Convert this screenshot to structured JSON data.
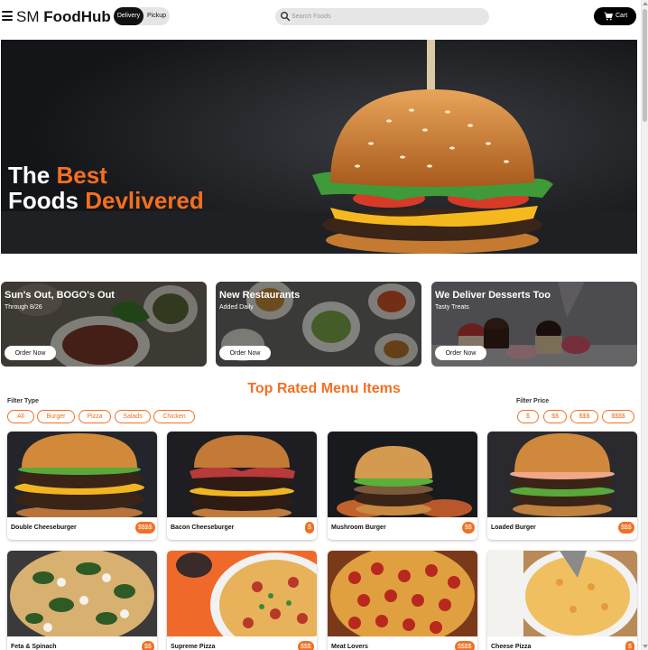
{
  "header": {
    "brand_prefix": "SM",
    "brand_name": "FoodHub",
    "toggle": {
      "active": "Delivery",
      "inactive": "Pickup"
    },
    "search_placeholder": "Search Foods",
    "cart_label": "Cart"
  },
  "hero": {
    "line1_plain": "The",
    "line1_accent": "Best",
    "line2_plain": "Foods",
    "line2_accent": "Devlivered"
  },
  "promos": [
    {
      "title": "Sun's Out, BOGO's Out",
      "subtitle": "Through 8/26",
      "button": "Order Now"
    },
    {
      "title": "New Restaurants",
      "subtitle": "Added Daily",
      "button": "Order Now"
    },
    {
      "title": "We Deliver Desserts Too",
      "subtitle": "Tasty Treats",
      "button": "Order Now"
    }
  ],
  "menu": {
    "title": "Top Rated Menu Items",
    "filter_type_label": "Filter Type",
    "filter_types": [
      "All",
      "Burger",
      "Pizza",
      "Salads",
      "Chicken"
    ],
    "filter_price_label": "Filter Price",
    "filter_prices": [
      "$",
      "$$",
      "$$$",
      "$$$$"
    ],
    "items": [
      {
        "name": "Double Cheeseburger",
        "price": "$$$$"
      },
      {
        "name": "Bacon Cheeseburger",
        "price": "$"
      },
      {
        "name": "Mushroom Burger",
        "price": "$$"
      },
      {
        "name": "Loaded Burger",
        "price": "$$$"
      },
      {
        "name": "Feta & Spinach",
        "price": "$$"
      },
      {
        "name": "Supreme Pizza",
        "price": "$$$"
      },
      {
        "name": "Meat Lovers",
        "price": "$$$$"
      },
      {
        "name": "Cheese Pizza",
        "price": "$"
      }
    ]
  },
  "colors": {
    "accent": "#f36f21",
    "dark": "#111111"
  }
}
